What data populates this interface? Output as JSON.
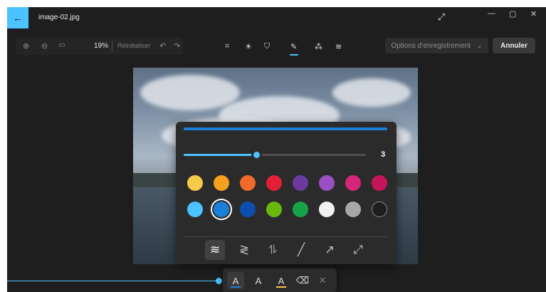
{
  "window": {
    "title": "image-02.jpg",
    "icons": {
      "back": "back-arrow-icon",
      "expand": "expand-icon",
      "minimize": "minimize-icon",
      "maximize": "maximize-icon",
      "close": "close-icon"
    }
  },
  "toolbar": {
    "zoom_level": "19%",
    "reset_label": "Réinitialiser",
    "icons": [
      "zoom-in-icon",
      "zoom-out-icon",
      "actual-size-icon",
      "undo-icon",
      "redo-icon"
    ]
  },
  "tools": {
    "items": [
      "crop-icon",
      "adjust-brightness-icon",
      "filter-icon",
      "markup-pen-icon",
      "retouch-icon",
      "background-icon"
    ],
    "active": "markup-pen-icon"
  },
  "actions": {
    "save_options_label": "Options d’enregistrement",
    "cancel_label": "Annuler"
  },
  "markup_panel": {
    "size_value": "3",
    "size_fraction": 0.4,
    "preview_color": "#1a7fd6",
    "colors": [
      "#f7c948",
      "#f7a21e",
      "#f06a2a",
      "#e21f36",
      "#6b3a9e",
      "#9b4fc4",
      "#d6267a",
      "#c7155a",
      "#4cc2ff",
      "#1a7fd6",
      "#0c4fb0",
      "#6ab80e",
      "#16a34a",
      "#f2f2f2",
      "#a8a8a8",
      "#1e1e1e"
    ],
    "selected_color_index": 9,
    "stroke_styles": [
      "freehand-stroke-icon",
      "freehand-arrow-stroke-icon",
      "freehand-double-arrow-stroke-icon",
      "line-icon",
      "arrow-icon",
      "double-arrow-icon"
    ],
    "active_stroke": 0
  },
  "sub_toolbar": {
    "tools": [
      "ballpoint-pen-icon",
      "pencil-icon",
      "highlighter-icon",
      "eraser-icon",
      "clear-all-icon"
    ],
    "active": 0
  }
}
